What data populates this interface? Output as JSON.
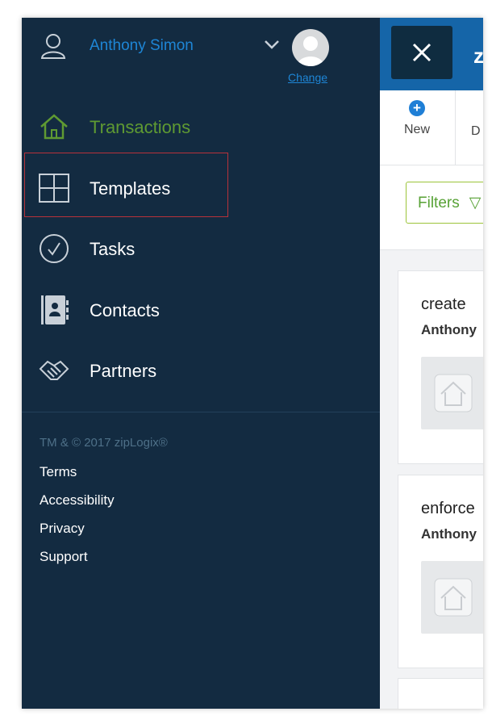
{
  "user": {
    "name": "Anthony Simon",
    "change_label": "Change"
  },
  "nav": [
    {
      "label": "Transactions",
      "icon": "home-icon",
      "active": true
    },
    {
      "label": "Templates",
      "icon": "grid-icon"
    },
    {
      "label": "Tasks",
      "icon": "check-circle-icon"
    },
    {
      "label": "Contacts",
      "icon": "address-book-icon"
    },
    {
      "label": "Partners",
      "icon": "handshake-icon"
    }
  ],
  "footer": {
    "copyright": "TM & © 2017 zipLogix®",
    "links": [
      "Terms",
      "Accessibility",
      "Privacy",
      "Support"
    ]
  },
  "app": {
    "header_letter": "z",
    "toolbar_new": "New",
    "toolbar_next": "D",
    "filters_label": "Filters",
    "cards": [
      {
        "title": "create",
        "subtitle": "Anthony"
      },
      {
        "title": "enforce",
        "subtitle": "Anthony"
      }
    ]
  },
  "colors": {
    "drawer_bg": "#132b41",
    "accent_blue": "#1e86d6",
    "active_green": "#5f9a32",
    "highlight_red": "#b8323a",
    "header_blue": "#1565a8"
  }
}
